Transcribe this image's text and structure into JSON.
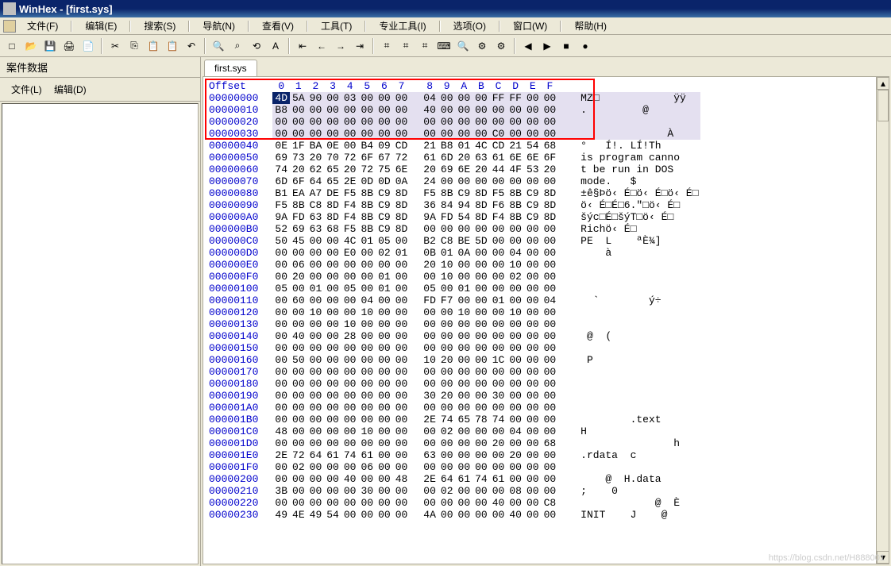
{
  "window": {
    "title": "WinHex - [first.sys]"
  },
  "menus": [
    "文件(F)",
    "编辑(E)",
    "搜索(S)",
    "导航(N)",
    "查看(V)",
    "工具(T)",
    "专业工具(I)",
    "选项(O)",
    "窗口(W)",
    "帮助(H)"
  ],
  "sidebar": {
    "title": "案件数据",
    "menu": [
      "文件(L)",
      "编辑(D)"
    ]
  },
  "tab": "first.sys",
  "header": {
    "offset_label": "Offset",
    "cols": [
      "0",
      "1",
      "2",
      "3",
      "4",
      "5",
      "6",
      "7",
      "8",
      "9",
      "A",
      "B",
      "C",
      "D",
      "E",
      "F"
    ]
  },
  "tool_icons": [
    "new",
    "open",
    "save",
    "print",
    "prop",
    "cut",
    "copy",
    "paste",
    "paste2",
    "undo",
    "find",
    "findhex",
    "replace",
    "highlight",
    "home",
    "back",
    "fwd",
    "end",
    "disk1",
    "disk2",
    "disk3",
    "calc",
    "zoom",
    "hash",
    "gear",
    "left",
    "right",
    "stop",
    "rec"
  ],
  "rows": [
    {
      "off": "00000000",
      "b": [
        "4D",
        "5A",
        "90",
        "00",
        "03",
        "00",
        "00",
        "00",
        "04",
        "00",
        "00",
        "00",
        "FF",
        "FF",
        "00",
        "00"
      ],
      "a": "MZ□            ÿÿ",
      "hl": true,
      "sel": 0
    },
    {
      "off": "00000010",
      "b": [
        "B8",
        "00",
        "00",
        "00",
        "00",
        "00",
        "00",
        "00",
        "40",
        "00",
        "00",
        "00",
        "00",
        "00",
        "00",
        "00"
      ],
      "a": ".         @",
      "hl": true
    },
    {
      "off": "00000020",
      "b": [
        "00",
        "00",
        "00",
        "00",
        "00",
        "00",
        "00",
        "00",
        "00",
        "00",
        "00",
        "00",
        "00",
        "00",
        "00",
        "00"
      ],
      "a": "",
      "hl": true
    },
    {
      "off": "00000030",
      "b": [
        "00",
        "00",
        "00",
        "00",
        "00",
        "00",
        "00",
        "00",
        "00",
        "00",
        "00",
        "00",
        "C0",
        "00",
        "00",
        "00"
      ],
      "a": "              À",
      "hl": true
    },
    {
      "off": "00000040",
      "b": [
        "0E",
        "1F",
        "BA",
        "0E",
        "00",
        "B4",
        "09",
        "CD",
        "21",
        "B8",
        "01",
        "4C",
        "CD",
        "21",
        "54",
        "68"
      ],
      "a": "°   Í!. LÍ!Th"
    },
    {
      "off": "00000050",
      "b": [
        "69",
        "73",
        "20",
        "70",
        "72",
        "6F",
        "67",
        "72",
        "61",
        "6D",
        "20",
        "63",
        "61",
        "6E",
        "6E",
        "6F"
      ],
      "a": "is program canno"
    },
    {
      "off": "00000060",
      "b": [
        "74",
        "20",
        "62",
        "65",
        "20",
        "72",
        "75",
        "6E",
        "20",
        "69",
        "6E",
        "20",
        "44",
        "4F",
        "53",
        "20"
      ],
      "a": "t be run in DOS "
    },
    {
      "off": "00000070",
      "b": [
        "6D",
        "6F",
        "64",
        "65",
        "2E",
        "0D",
        "0D",
        "0A",
        "24",
        "00",
        "00",
        "00",
        "00",
        "00",
        "00",
        "00"
      ],
      "a": "mode.   $"
    },
    {
      "off": "00000080",
      "b": [
        "B1",
        "EA",
        "A7",
        "DE",
        "F5",
        "8B",
        "C9",
        "8D",
        "F5",
        "8B",
        "C9",
        "8D",
        "F5",
        "8B",
        "C9",
        "8D"
      ],
      "a": "±ê§Þö‹ É□ö‹ É□ö‹ É□"
    },
    {
      "off": "00000090",
      "b": [
        "F5",
        "8B",
        "C8",
        "8D",
        "F4",
        "8B",
        "C9",
        "8D",
        "36",
        "84",
        "94",
        "8D",
        "F6",
        "8B",
        "C9",
        "8D"
      ],
      "a": "ö‹ É□É□6.″□ö‹ É□"
    },
    {
      "off": "000000A0",
      "b": [
        "9A",
        "FD",
        "63",
        "8D",
        "F4",
        "8B",
        "C9",
        "8D",
        "9A",
        "FD",
        "54",
        "8D",
        "F4",
        "8B",
        "C9",
        "8D"
      ],
      "a": "šýc□É□šýT□ö‹ É□"
    },
    {
      "off": "000000B0",
      "b": [
        "52",
        "69",
        "63",
        "68",
        "F5",
        "8B",
        "C9",
        "8D",
        "00",
        "00",
        "00",
        "00",
        "00",
        "00",
        "00",
        "00"
      ],
      "a": "Richö‹ É□"
    },
    {
      "off": "000000C0",
      "b": [
        "50",
        "45",
        "00",
        "00",
        "4C",
        "01",
        "05",
        "00",
        "B2",
        "C8",
        "BE",
        "5D",
        "00",
        "00",
        "00",
        "00"
      ],
      "a": "PE  L    ªÈ¾]"
    },
    {
      "off": "000000D0",
      "b": [
        "00",
        "00",
        "00",
        "00",
        "E0",
        "00",
        "02",
        "01",
        "0B",
        "01",
        "0A",
        "00",
        "00",
        "04",
        "00",
        "00"
      ],
      "a": "    à"
    },
    {
      "off": "000000E0",
      "b": [
        "00",
        "06",
        "00",
        "00",
        "00",
        "00",
        "00",
        "00",
        "20",
        "10",
        "00",
        "00",
        "00",
        "10",
        "00",
        "00"
      ],
      "a": ""
    },
    {
      "off": "000000F0",
      "b": [
        "00",
        "20",
        "00",
        "00",
        "00",
        "00",
        "01",
        "00",
        "00",
        "10",
        "00",
        "00",
        "00",
        "02",
        "00",
        "00"
      ],
      "a": ""
    },
    {
      "off": "00000100",
      "b": [
        "05",
        "00",
        "01",
        "00",
        "05",
        "00",
        "01",
        "00",
        "05",
        "00",
        "01",
        "00",
        "00",
        "00",
        "00",
        "00"
      ],
      "a": ""
    },
    {
      "off": "00000110",
      "b": [
        "00",
        "60",
        "00",
        "00",
        "00",
        "04",
        "00",
        "00",
        "FD",
        "F7",
        "00",
        "00",
        "01",
        "00",
        "00",
        "04"
      ],
      "a": "  `        ý÷"
    },
    {
      "off": "00000120",
      "b": [
        "00",
        "00",
        "10",
        "00",
        "00",
        "10",
        "00",
        "00",
        "00",
        "00",
        "10",
        "00",
        "00",
        "10",
        "00",
        "00"
      ],
      "a": ""
    },
    {
      "off": "00000130",
      "b": [
        "00",
        "00",
        "00",
        "00",
        "10",
        "00",
        "00",
        "00",
        "00",
        "00",
        "00",
        "00",
        "00",
        "00",
        "00",
        "00"
      ],
      "a": ""
    },
    {
      "off": "00000140",
      "b": [
        "00",
        "40",
        "00",
        "00",
        "28",
        "00",
        "00",
        "00",
        "00",
        "00",
        "00",
        "00",
        "00",
        "00",
        "00",
        "00"
      ],
      "a": " @  ("
    },
    {
      "off": "00000150",
      "b": [
        "00",
        "00",
        "00",
        "00",
        "00",
        "00",
        "00",
        "00",
        "00",
        "00",
        "00",
        "00",
        "00",
        "00",
        "00",
        "00"
      ],
      "a": ""
    },
    {
      "off": "00000160",
      "b": [
        "00",
        "50",
        "00",
        "00",
        "00",
        "00",
        "00",
        "00",
        "10",
        "20",
        "00",
        "00",
        "1C",
        "00",
        "00",
        "00"
      ],
      "a": " P"
    },
    {
      "off": "00000170",
      "b": [
        "00",
        "00",
        "00",
        "00",
        "00",
        "00",
        "00",
        "00",
        "00",
        "00",
        "00",
        "00",
        "00",
        "00",
        "00",
        "00"
      ],
      "a": ""
    },
    {
      "off": "00000180",
      "b": [
        "00",
        "00",
        "00",
        "00",
        "00",
        "00",
        "00",
        "00",
        "00",
        "00",
        "00",
        "00",
        "00",
        "00",
        "00",
        "00"
      ],
      "a": ""
    },
    {
      "off": "00000190",
      "b": [
        "00",
        "00",
        "00",
        "00",
        "00",
        "00",
        "00",
        "00",
        "30",
        "20",
        "00",
        "00",
        "30",
        "00",
        "00",
        "00"
      ],
      "a": ""
    },
    {
      "off": "000001A0",
      "b": [
        "00",
        "00",
        "00",
        "00",
        "00",
        "00",
        "00",
        "00",
        "00",
        "00",
        "00",
        "00",
        "00",
        "00",
        "00",
        "00"
      ],
      "a": ""
    },
    {
      "off": "000001B0",
      "b": [
        "00",
        "00",
        "00",
        "00",
        "00",
        "00",
        "00",
        "00",
        "2E",
        "74",
        "65",
        "78",
        "74",
        "00",
        "00",
        "00"
      ],
      "a": "        .text"
    },
    {
      "off": "000001C0",
      "b": [
        "48",
        "00",
        "00",
        "00",
        "00",
        "10",
        "00",
        "00",
        "00",
        "02",
        "00",
        "00",
        "00",
        "04",
        "00",
        "00"
      ],
      "a": "H"
    },
    {
      "off": "000001D0",
      "b": [
        "00",
        "00",
        "00",
        "00",
        "00",
        "00",
        "00",
        "00",
        "00",
        "00",
        "00",
        "00",
        "20",
        "00",
        "00",
        "68"
      ],
      "a": "               h"
    },
    {
      "off": "000001E0",
      "b": [
        "2E",
        "72",
        "64",
        "61",
        "74",
        "61",
        "00",
        "00",
        "63",
        "00",
        "00",
        "00",
        "00",
        "20",
        "00",
        "00"
      ],
      "a": ".rdata  c"
    },
    {
      "off": "000001F0",
      "b": [
        "00",
        "02",
        "00",
        "00",
        "00",
        "06",
        "00",
        "00",
        "00",
        "00",
        "00",
        "00",
        "00",
        "00",
        "00",
        "00"
      ],
      "a": ""
    },
    {
      "off": "00000200",
      "b": [
        "00",
        "00",
        "00",
        "00",
        "40",
        "00",
        "00",
        "48",
        "2E",
        "64",
        "61",
        "74",
        "61",
        "00",
        "00",
        "00"
      ],
      "a": "    @  H.data"
    },
    {
      "off": "00000210",
      "b": [
        "3B",
        "00",
        "00",
        "00",
        "00",
        "30",
        "00",
        "00",
        "00",
        "02",
        "00",
        "00",
        "00",
        "08",
        "00",
        "00"
      ],
      "a": ";    0"
    },
    {
      "off": "00000220",
      "b": [
        "00",
        "00",
        "00",
        "00",
        "00",
        "00",
        "00",
        "00",
        "00",
        "00",
        "00",
        "00",
        "40",
        "00",
        "00",
        "C8"
      ],
      "a": "            @  È"
    },
    {
      "off": "00000230",
      "b": [
        "49",
        "4E",
        "49",
        "54",
        "00",
        "00",
        "00",
        "00",
        "4A",
        "00",
        "00",
        "00",
        "00",
        "40",
        "00",
        "00"
      ],
      "a": "INIT    J    @"
    }
  ],
  "watermark": "https://blog.csdn.net/H888001"
}
